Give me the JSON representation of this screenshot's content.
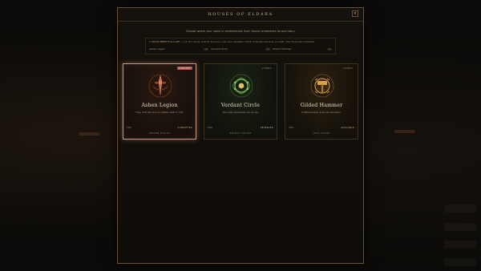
{
  "modal": {
    "title": "HOUSES OF ELDARA",
    "close_label": "×",
    "intro": "Choose where your name is remembered. Each House remembers its own story.",
    "notice": {
      "lead": "A HOUSE BENEFIT IS A GIFT",
      "text": " — join the house, it lends its favour, and your reputation within it follows wherever you walk. The House will remember."
    },
    "reputations": [
      {
        "name": "Ashen Legion",
        "value": "0"
      },
      {
        "name": "Verdant Circle",
        "value": "0"
      },
      {
        "name": "Gilded Hammer",
        "value": "0"
      }
    ]
  },
  "houses": [
    {
      "name": "Ashen Legion",
      "badge": "CURRENT",
      "description": "They hold the line no matter what it cost.",
      "foot_left": "TIER",
      "foot_mid": "· · · ·",
      "foot_right": "COMMITTED",
      "action": "SWORN HOUSE",
      "icon": "ashen-sword-emblem-icon",
      "accent": "#c46a4e"
    },
    {
      "name": "Verdant Circle",
      "badge": "JOINED",
      "description": "The roots remember. So do we.",
      "foot_left": "TIER",
      "foot_mid": "· · · ·",
      "foot_right": "RESERVED",
      "action": "SWITCH HOUSE",
      "icon": "verdant-wreath-emblem-icon",
      "accent": "#6fae58"
    },
    {
      "name": "Gilded Hammer",
      "badge": "JOINED",
      "description": "Craftsmanship is its own devotion.",
      "foot_left": "TIER",
      "foot_mid": "· · · ·",
      "foot_right": "AVAILABLE",
      "action": "JOIN HOUSE",
      "icon": "gilded-hammer-emblem-icon",
      "accent": "#d9a441"
    }
  ]
}
